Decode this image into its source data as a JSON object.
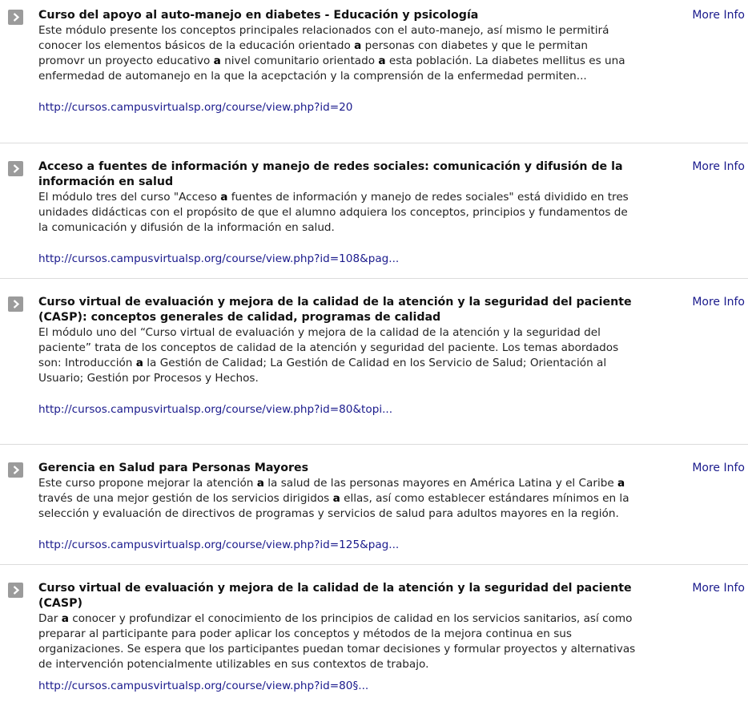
{
  "more_info_label": "More Info",
  "results": [
    {
      "title": "Curso del apoyo al auto-manejo en diabetes - Educación y psicología",
      "snippet": "Este módulo presente los conceptos principales relacionados con el auto-manejo, así mismo le permitirá conocer los elementos básicos de la educación orientado a personas con diabetes y que le permitan promovr un proyecto educativo a nivel comunitario orientado a esta población. La diabetes mellitus es una enfermedad de automanejo en la que la acepctación y la comprensión de la enfermedad permiten...",
      "url": "http://cursos.campusvirtualsp.org/course/view.php?id=20"
    },
    {
      "title": "Acceso a fuentes de información y manejo de redes sociales: comunicación y difusión de la información en salud",
      "snippet": "El módulo tres del curso \"Acceso a fuentes de información y manejo de redes sociales\" está dividido en tres unidades didácticas con el propósito de que el alumno adquiera los conceptos, principios y fundamentos de la comunicación y difusión de la información en salud.",
      "url": "http://cursos.campusvirtualsp.org/course/view.php?id=108&pag..."
    },
    {
      "title": "Curso virtual de evaluación y mejora de la calidad de la atención y la seguridad del paciente (CASP): conceptos generales de calidad, programas de calidad",
      "snippet": "El módulo uno del “Curso virtual de evaluación y mejora de la calidad de la atención y la seguridad del paciente” trata de los conceptos de calidad de la atención y seguridad del paciente. Los temas abordados son: Introducción a la Gestión de Calidad; La Gestión de Calidad en los Servicio de Salud; Orientación al Usuario; Gestión por Procesos y Hechos.",
      "url": "http://cursos.campusvirtualsp.org/course/view.php?id=80&topi..."
    },
    {
      "title": "Gerencia en Salud para Personas Mayores",
      "snippet": "Este curso propone mejorar la atención a la salud de las personas mayores en América Latina y el Caribe a través de una mejor gestión de los servicios dirigidos a ellas, así como establecer estándares mínimos en la selección y evaluación de directivos de programas y servicios de salud para adultos mayores en la región.",
      "url": "http://cursos.campusvirtualsp.org/course/view.php?id=125&pag..."
    },
    {
      "title": "Curso virtual de evaluación y mejora de la calidad de la atención y la seguridad del paciente (CASP)",
      "snippet": "Dar a conocer y profundizar el conocimiento de los principios de calidad en los servicios sanitarios, así como preparar al participante para poder aplicar los conceptos y métodos de la mejora continua en sus organizaciones. Se espera que los participantes puedan tomar decisiones y formular proyectos y alternativas de intervención potencialmente utilizables en sus contextos de trabajo.",
      "url": "http://cursos.campusvirtualsp.org/course/view.php?id=80§..."
    }
  ]
}
